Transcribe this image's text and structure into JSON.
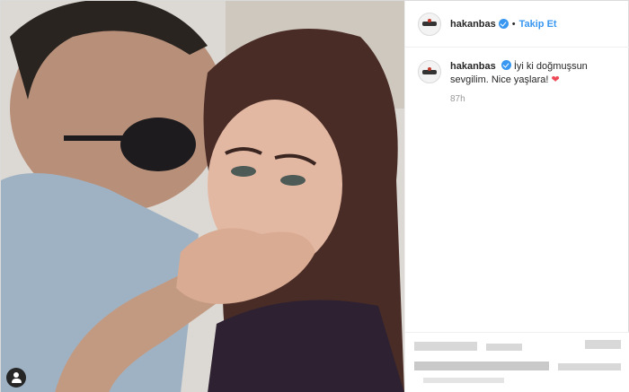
{
  "post": {
    "header": {
      "username": "hakanbas",
      "separator": "•",
      "follow_label": "Takip Et"
    },
    "caption": {
      "username": "hakanbas",
      "text": "İyi ki doğmuşsun sevgilim. Nice yaşlara!",
      "heart": "❤"
    },
    "timestamp": "87h",
    "photo_alt": "couple-selfie",
    "colors": {
      "follow": "#3897f0",
      "verified": "#3897f0",
      "heart": "#ed4956"
    }
  }
}
